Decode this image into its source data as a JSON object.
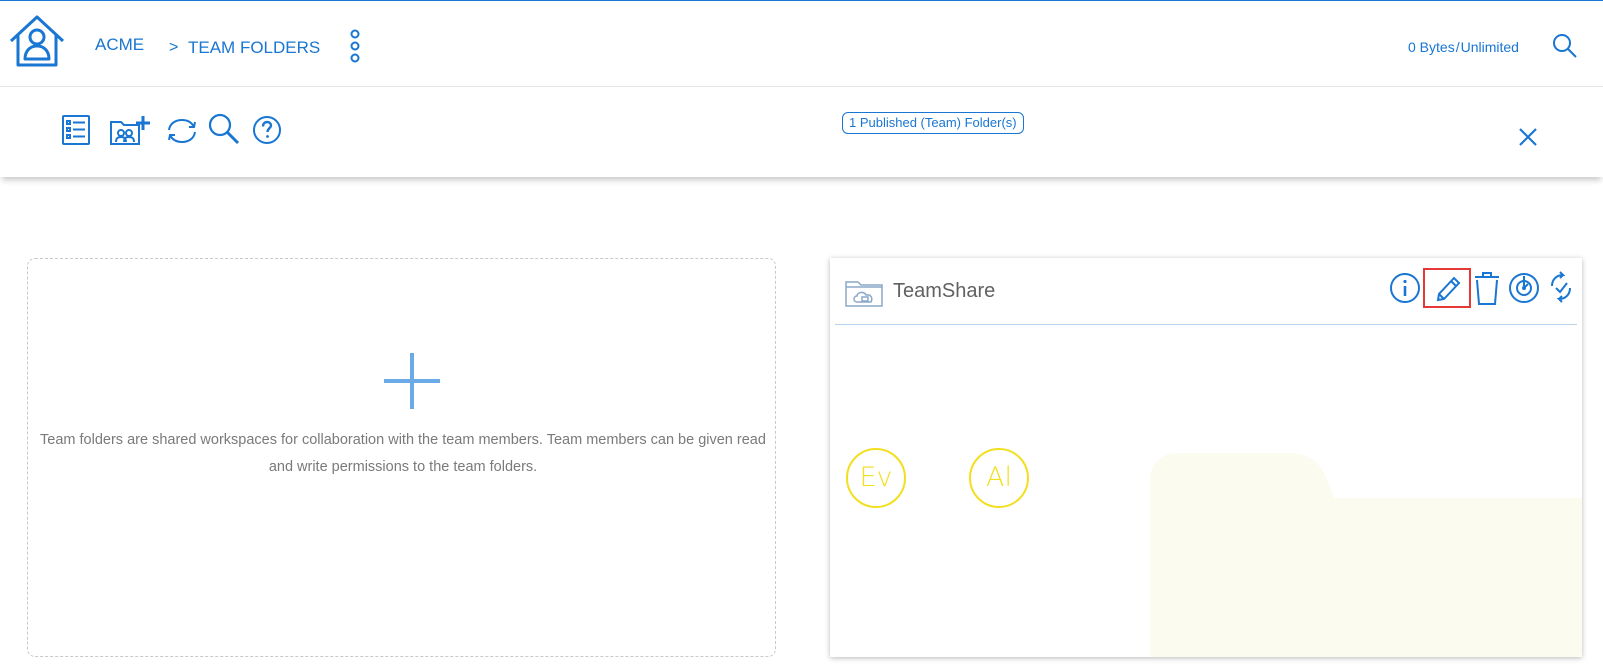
{
  "header": {
    "breadcrumb_root": "ACME",
    "breadcrumb_separator": ">",
    "breadcrumb_current": "TEAM FOLDERS",
    "quota_used": "0 Bytes",
    "quota_separator": "/",
    "quota_limit": "Unlimited"
  },
  "toolbar": {
    "icons": [
      "list-view-icon",
      "add-team-folder-icon",
      "refresh-icon",
      "search-icon",
      "help-icon"
    ],
    "published_count_label": "1 Published (Team) Folder(s)",
    "close_icon": "close-icon"
  },
  "new_folder_card": {
    "icon": "plus-icon",
    "description": "Team folders are shared workspaces for collaboration with the team members. Team members can be given read and write permissions to the team folders."
  },
  "team_folders": [
    {
      "name": "TeamShare",
      "icon": "cloud-folder-icon",
      "actions": [
        "info-icon",
        "edit-icon",
        "delete-icon",
        "sync-icon",
        "resync-icon"
      ],
      "highlighted_action": "edit-icon",
      "members": [
        {
          "initials": "Ev"
        },
        {
          "initials": "Al"
        }
      ]
    }
  ],
  "colors": {
    "accent": "#1976d2",
    "avatar": "#f2df1f",
    "highlight": "#e53935",
    "muted_text": "#7a7a7a"
  }
}
